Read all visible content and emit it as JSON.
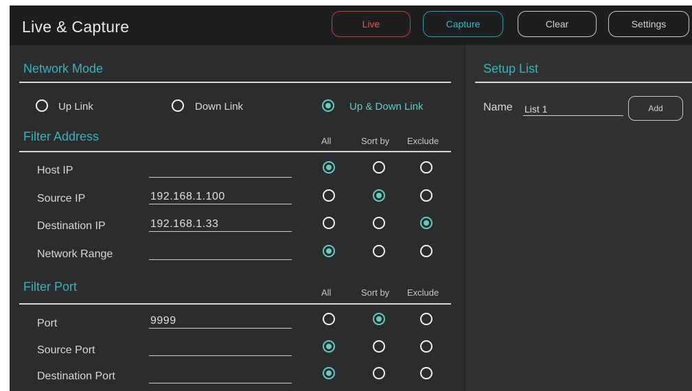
{
  "app": {
    "title": "Live & Capture"
  },
  "toolbar": {
    "live": "Live",
    "capture": "Capture",
    "clear": "Clear",
    "settings": "Settings"
  },
  "network_mode": {
    "title": "Network Mode",
    "options": [
      {
        "label": "Up Link",
        "selected": false
      },
      {
        "label": "Down Link",
        "selected": false
      },
      {
        "label": "Up & Down Link",
        "selected": true
      }
    ]
  },
  "filter_address": {
    "title": "Filter Address",
    "columns": [
      "All",
      "Sort by",
      "Exclude"
    ],
    "rows": [
      {
        "label": "Host IP",
        "value": "",
        "selected": "All"
      },
      {
        "label": "Source IP",
        "value": "192.168.1.100",
        "selected": "Sort by"
      },
      {
        "label": "Destination IP",
        "value": "192.168.1.33",
        "selected": "Exclude"
      },
      {
        "label": "Network Range",
        "value": "",
        "selected": "All"
      }
    ]
  },
  "filter_port": {
    "title": "Filter Port",
    "columns": [
      "All",
      "Sort by",
      "Exclude"
    ],
    "rows": [
      {
        "label": "Port",
        "value": "9999",
        "selected": "Sort by"
      },
      {
        "label": "Source Port",
        "value": "",
        "selected": "All"
      },
      {
        "label": "Destination Port",
        "value": "",
        "selected": "All"
      }
    ]
  },
  "setup_list": {
    "title": "Setup List",
    "name_label": "Name",
    "name_value": "List 1",
    "add_label": "Add"
  },
  "colors": {
    "accent": "#3fb0ba",
    "radio_on": "#68c9c0",
    "live": "#e05a52",
    "capture": "#3fb5bf",
    "background": "#2a2c2e"
  }
}
